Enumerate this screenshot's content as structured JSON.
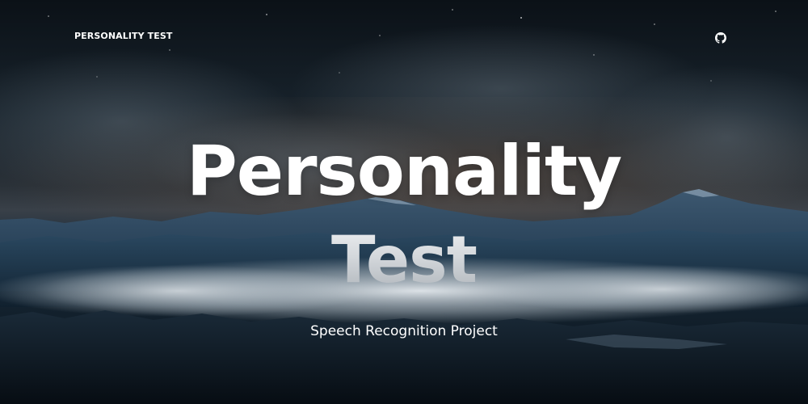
{
  "nav": {
    "brand": "PERSONALITY TEST",
    "github_icon": "github-icon"
  },
  "hero": {
    "title_line1": "Personality",
    "title_line2": "Test",
    "subtitle": "Speech Recognition Project"
  },
  "colors": {
    "text": "#ffffff",
    "sky_top": "#0b1117",
    "mist": "#dfe4e8",
    "mountain": "#1e3a52"
  }
}
